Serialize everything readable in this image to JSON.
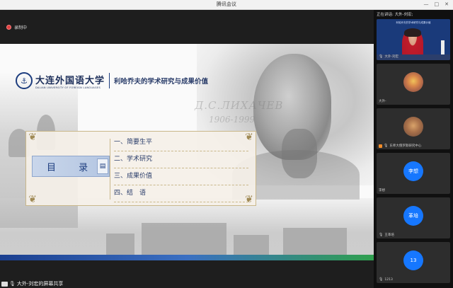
{
  "window": {
    "title": "腾讯会议"
  },
  "recording": {
    "label": "录制中"
  },
  "slide": {
    "university_cn": "大连外国语大学",
    "university_en": "DALIAN UNIVERSITY OF FOREIGN LANGUAGES",
    "topic": "利哈乔夫的学术研究与成果价值",
    "signature": "Д.С.ЛИХАЧЕВ",
    "years": "1906-1999",
    "toc_title": "目 录",
    "toc_items": [
      "一、简要生平",
      "二、学术研究",
      "三、成果价值",
      "四、结　语"
    ]
  },
  "share": {
    "label": "大外-刘宏的屏幕共享"
  },
  "sidebar": {
    "speaking": "正在讲话: 大外-刘宏;",
    "tiles": [
      {
        "name": "大外-刘宏",
        "kind": "video",
        "banner": "利哈乔夫的学术研究与成果价值"
      },
      {
        "name": "大外-",
        "kind": "image"
      },
      {
        "name": "东师大俄罗斯研究中心",
        "kind": "image"
      },
      {
        "name": "李想",
        "kind": "initials",
        "initials": "李想"
      },
      {
        "name": "王革培",
        "kind": "initials",
        "initials": "革培"
      },
      {
        "name": "1213",
        "kind": "initials",
        "initials": "13"
      }
    ]
  }
}
